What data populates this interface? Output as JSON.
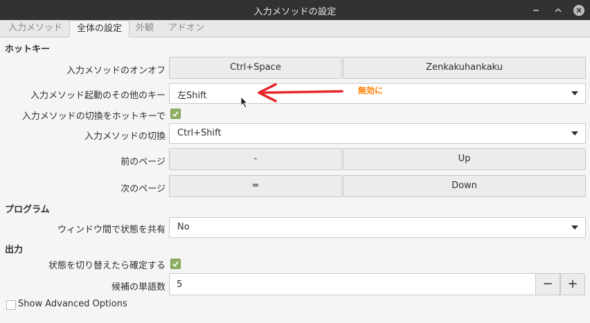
{
  "window": {
    "title": "入力メソッドの設定"
  },
  "tabs": [
    {
      "label": "入力メソッド"
    },
    {
      "label": "全体の設定"
    },
    {
      "label": "外観"
    },
    {
      "label": "アドオン"
    }
  ],
  "hotkey": {
    "section_title": "ホットキー",
    "toggle_label": "入力メソッドのオンオフ",
    "toggle_key1": "Ctrl+Space",
    "toggle_key2": "Zenkakuhankaku",
    "other_label": "入力メソッド起動のその他のキー",
    "other_value": "左Shift",
    "enable_switch_label": "入力メソッドの切換をホットキーで",
    "switch_label": "入力メソッドの切換",
    "switch_value": "Ctrl+Shift",
    "prev_page_label": "前のページ",
    "prev_page_key1": "-",
    "prev_page_key2": "Up",
    "next_page_label": "次のページ",
    "next_page_key1": "=",
    "next_page_key2": "Down"
  },
  "program": {
    "section_title": "プログラム",
    "share_label": "ウィンドウ間で状態を共有",
    "share_value": "No"
  },
  "output": {
    "section_title": "出力",
    "commit_label": "状態を切り替えたら確定する",
    "candidate_label": "候補の単語数",
    "candidate_value": "5",
    "minus": "−",
    "plus": "+"
  },
  "advanced": {
    "label": "Show Advanced Options"
  },
  "annotation": {
    "text": "無効に",
    "color": "#e8262a"
  },
  "colors": {
    "titlebar": "#323232",
    "check": "#8fb064",
    "annotation_text": "#ff8000"
  }
}
